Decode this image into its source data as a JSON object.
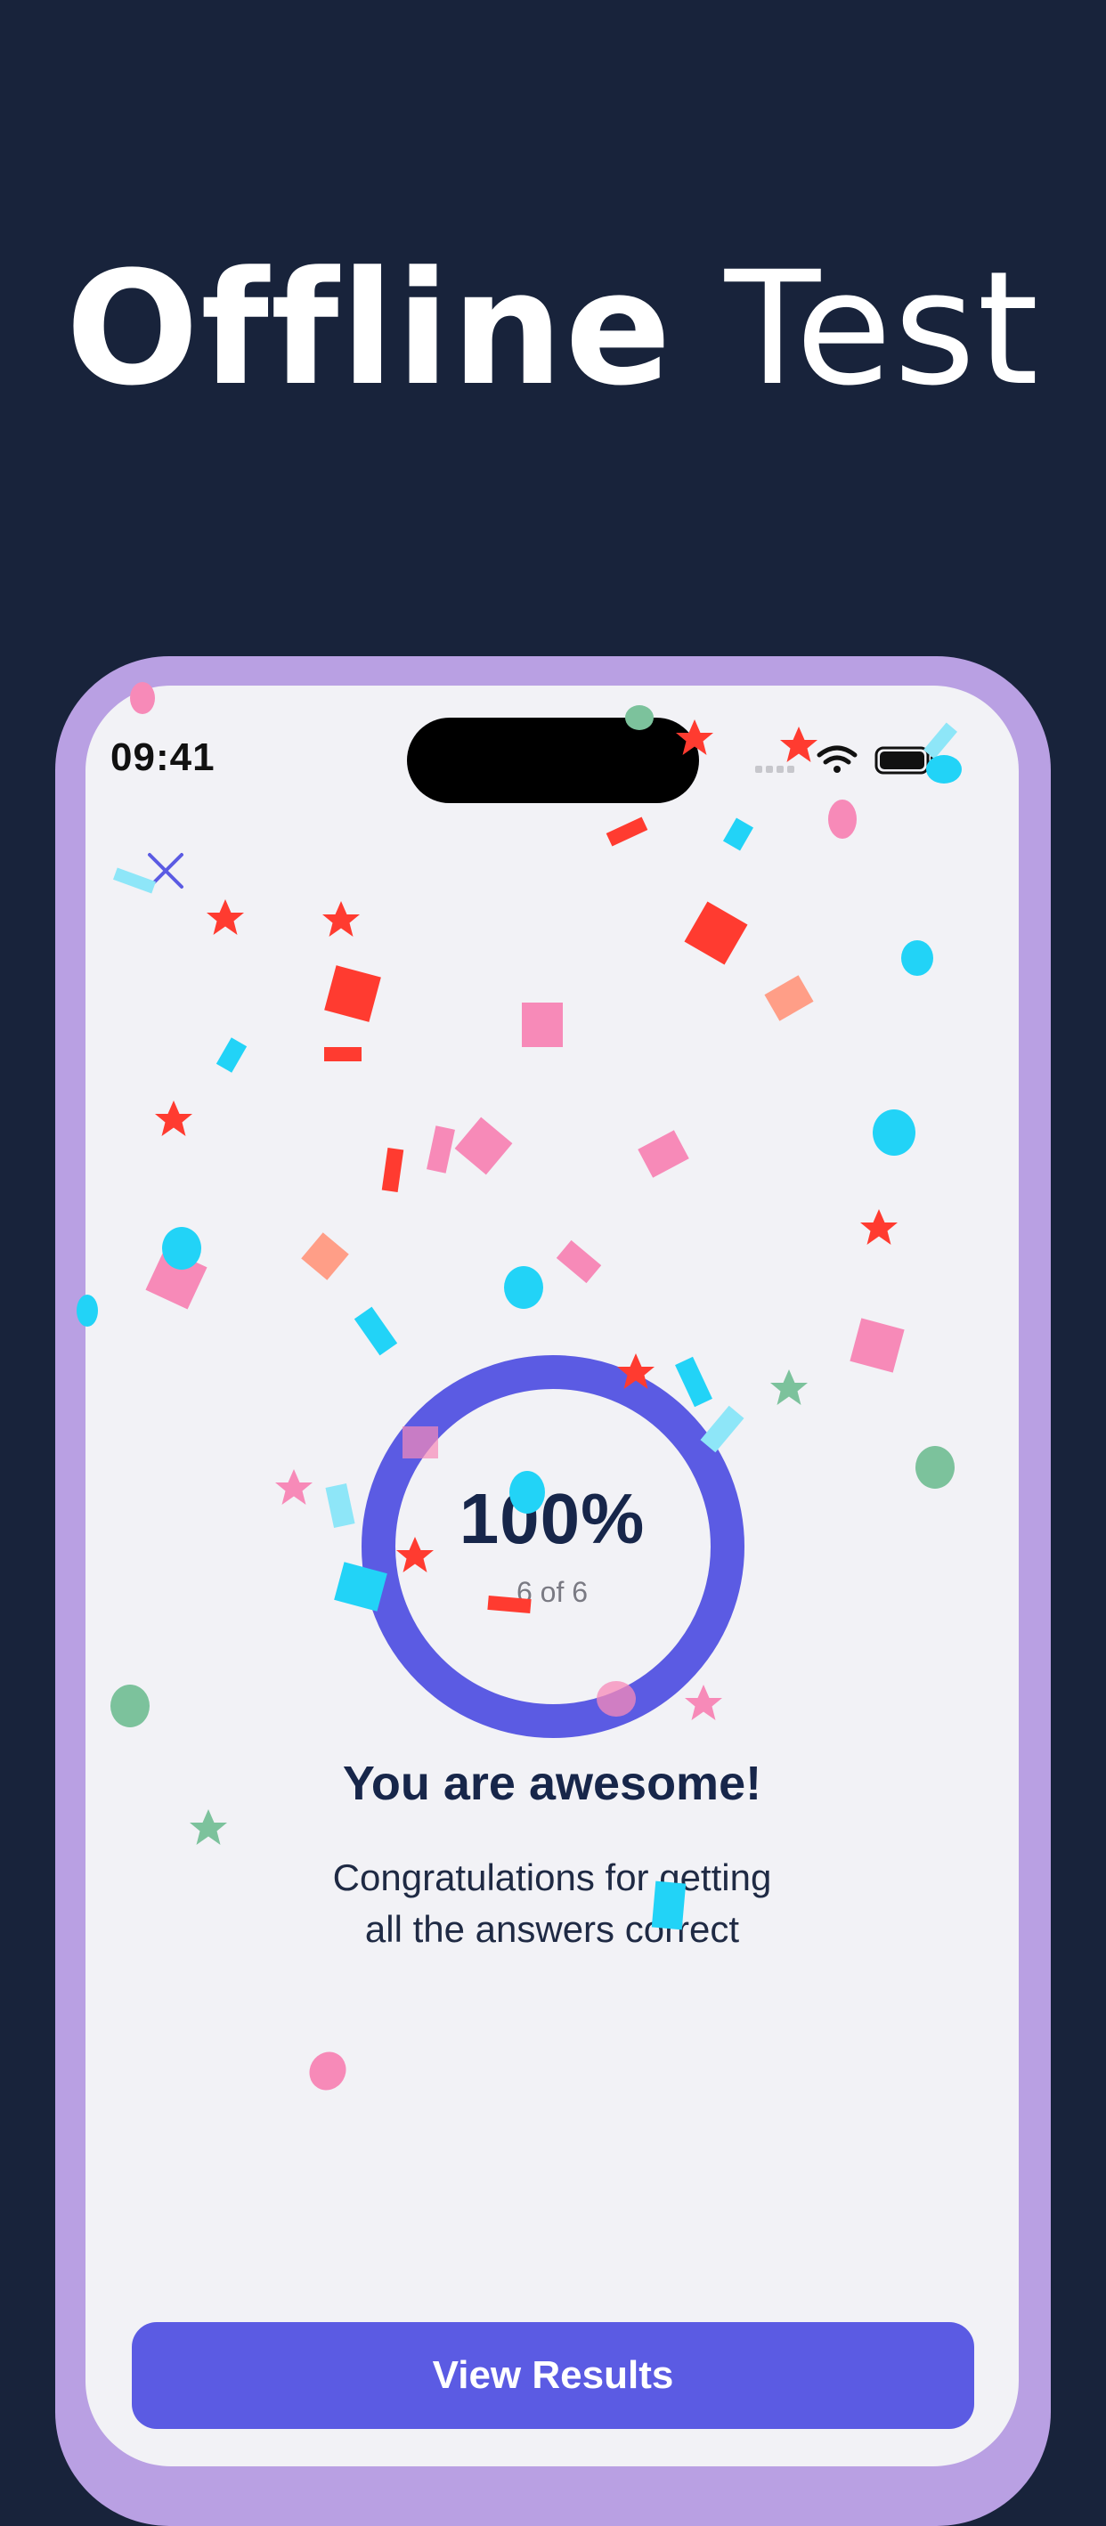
{
  "headline": {
    "bold": "Offline",
    "light": "Test"
  },
  "status_bar": {
    "time": "09:41",
    "icons": [
      "cellular-icon",
      "wifi-icon",
      "battery-icon"
    ]
  },
  "toolbar": {
    "close_icon": "close-icon"
  },
  "result": {
    "percent_label": "100%",
    "progress_fraction": 1.0,
    "count_label": "6 of 6",
    "title": "You are awesome!",
    "message_line1": "Congratulations for getting",
    "message_line2": "all the answers correct"
  },
  "actions": {
    "view_results_label": "View Results"
  },
  "colors": {
    "background": "#18233b",
    "frame": "#b9a0e3",
    "screen": "#f2f2f6",
    "accent": "#5b5be3",
    "confetti": [
      "#ff3b30",
      "#f78ab8",
      "#22d3f7",
      "#7cc29c",
      "#ff9e87"
    ]
  }
}
